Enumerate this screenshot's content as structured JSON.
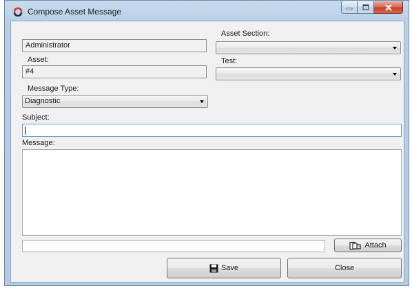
{
  "window": {
    "title": "Compose Asset Message"
  },
  "form": {
    "user_value": "Administrator",
    "asset_label": "Asset:",
    "asset_value": "#4",
    "message_type_label": "Message Type:",
    "message_type_value": "Diagnostic",
    "asset_section_label": "Asset Section:",
    "asset_section_value": "",
    "test_label": "Test:",
    "test_value": "",
    "subject_label": "Subject:",
    "subject_value": "",
    "message_label": "Message:",
    "message_value": "",
    "attachment_path": ""
  },
  "buttons": {
    "attach": "Attach",
    "save": "Save",
    "close": "Close"
  },
  "icons": {
    "app": "app-logo-icon",
    "attach": "attach-icon",
    "save": "floppy-disk-icon"
  }
}
